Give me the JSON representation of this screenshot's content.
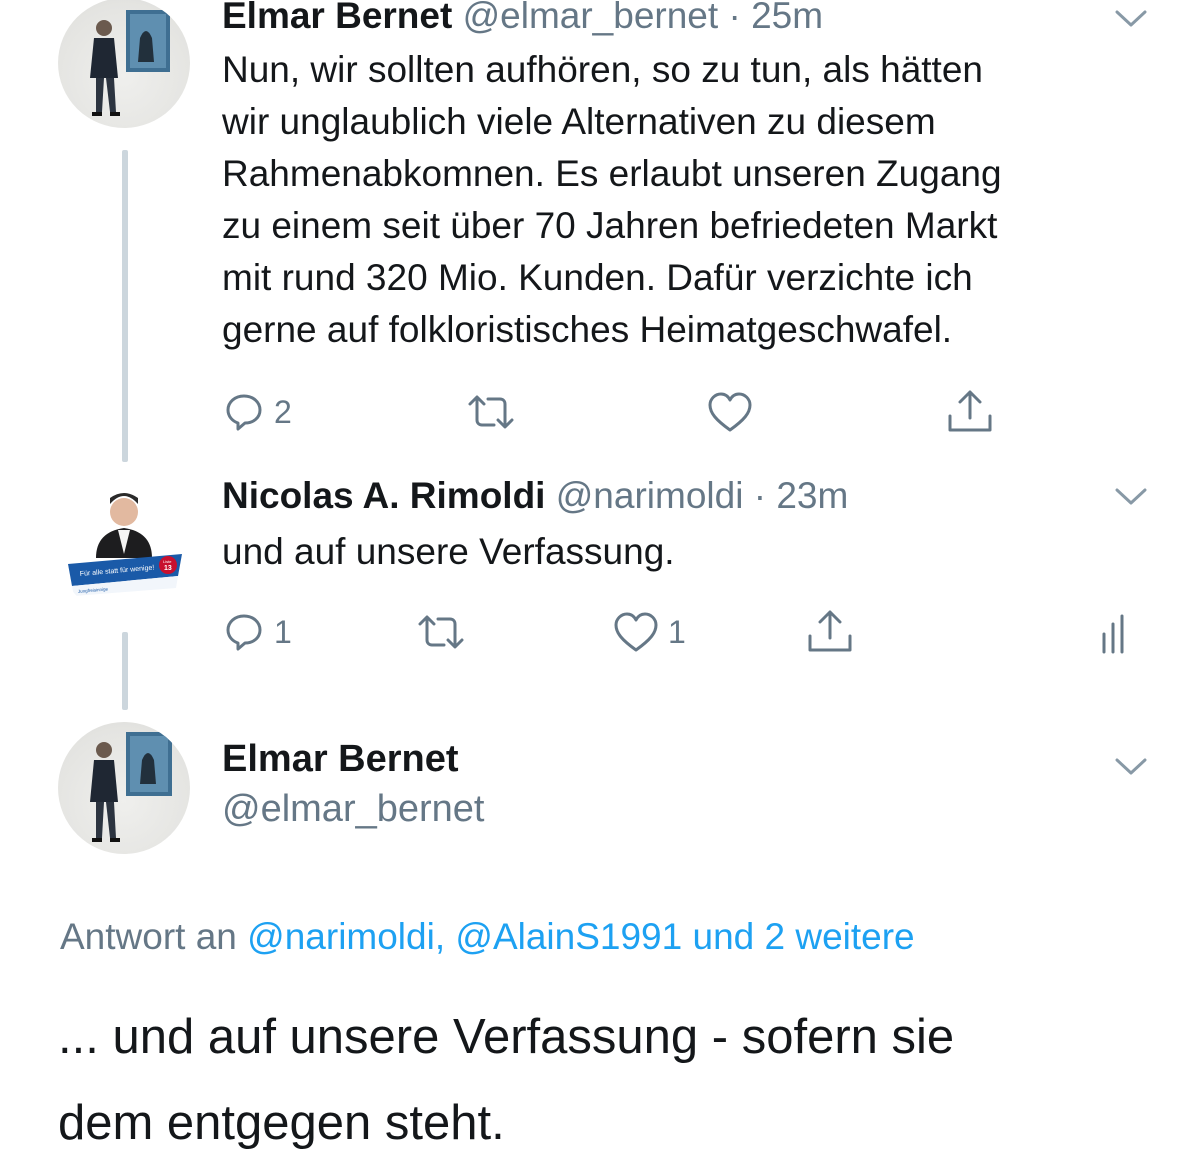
{
  "tweets": [
    {
      "name": "Elmar Bernet",
      "handle": "@elmar_bernet",
      "separator": "·",
      "time": "25m",
      "text_lines": [
        "Nun, wir sollten aufhören, so zu tun, als hätten",
        "wir unglaublich viele Alternativen zu diesem",
        "Rahmenabkomnen. Es erlaubt unseren Zugang",
        "zu einem seit über 70 Jahren befriedeten Markt",
        "mit rund 320 Mio. Kunden. Dafür verzichte ich",
        "gerne auf folkloristisches Heimatgeschwafel."
      ],
      "reply_count": "2",
      "retweet_count": "",
      "like_count": ""
    },
    {
      "name": "Nicolas A. Rimoldi",
      "handle": "@narimoldi",
      "separator": "·",
      "time": "23m",
      "text": "und auf unsere Verfassung.",
      "reply_count": "1",
      "retweet_count": "",
      "like_count": "1",
      "banner_text": "Für alle statt für wenige!",
      "banner_list_label": "Liste",
      "banner_list_number": "13",
      "banner_org": "Jungfreisinnige"
    }
  ],
  "main_tweet": {
    "name": "Elmar Bernet",
    "handle": "@elmar_bernet",
    "reply_prefix": "Antwort an",
    "reply_mentions": "@narimoldi, @AlainS1991 und 2 weitere",
    "text_line_1": "... und auf unsere Verfassung - sofern sie",
    "text_line_2": "dem entgegen steht."
  },
  "icons": {
    "reply": "reply-icon",
    "retweet": "retweet-icon",
    "like": "heart-icon",
    "share": "share-icon",
    "analytics": "analytics-icon",
    "more": "chevron-down-icon"
  },
  "colors": {
    "text": "#14171a",
    "secondary": "#657786",
    "link": "#1da1f2",
    "thread_line": "#ccd6dd"
  }
}
